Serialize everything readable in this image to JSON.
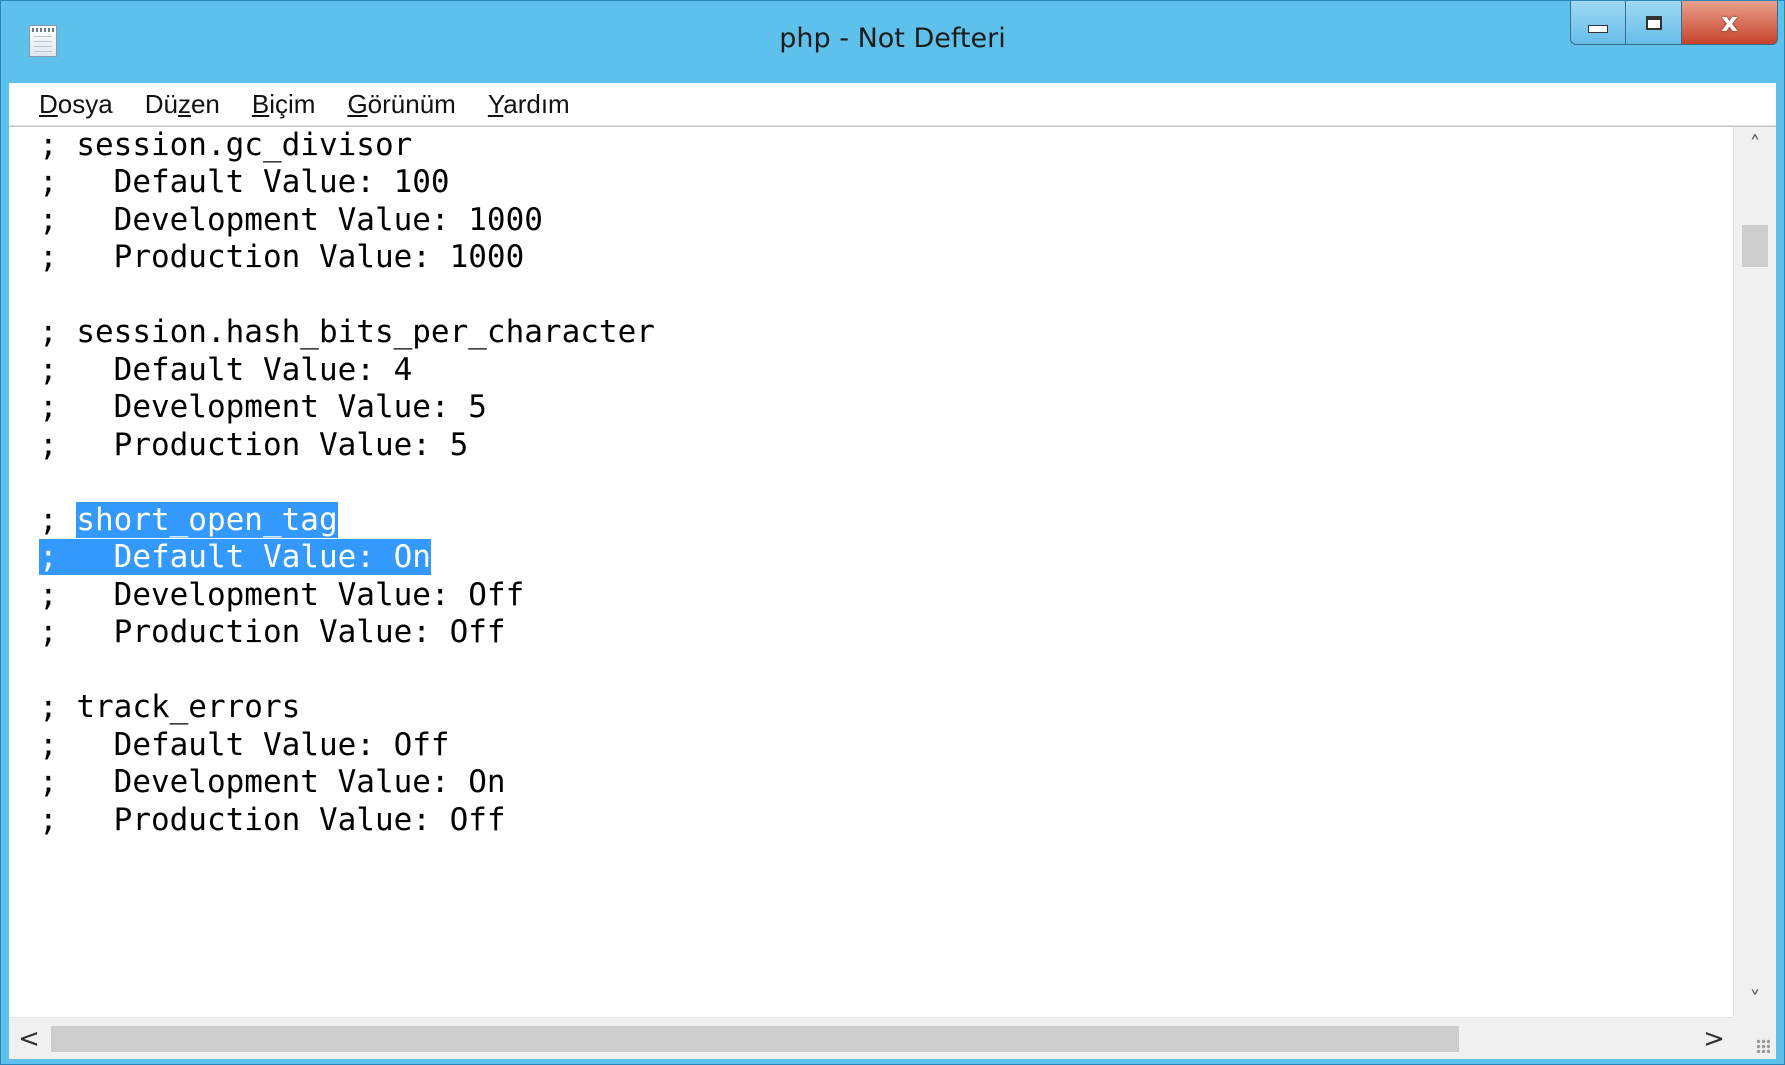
{
  "window": {
    "title": "php - Not Defteri",
    "close_glyph": "x"
  },
  "menu": [
    {
      "accel": "D",
      "rest": "osya"
    },
    {
      "pre": "Dü",
      "accel": "z",
      "rest": "en"
    },
    {
      "accel": "B",
      "rest": "içim"
    },
    {
      "accel": "G",
      "rest": "örünüm"
    },
    {
      "accel": "Y",
      "rest": "ardım"
    }
  ],
  "editor": {
    "lines": [
      {
        "text": "; session.gc_divisor"
      },
      {
        "text": ";   Default Value: 100"
      },
      {
        "text": ";   Development Value: 1000"
      },
      {
        "text": ";   Production Value: 1000"
      },
      {
        "text": ""
      },
      {
        "text": "; session.hash_bits_per_character"
      },
      {
        "text": ";   Default Value: 4"
      },
      {
        "text": ";   Development Value: 5"
      },
      {
        "text": ";   Production Value: 5"
      },
      {
        "text": ""
      },
      {
        "text": "; ",
        "selected": "short_open_tag"
      },
      {
        "text": "",
        "selected": ";   Default Value: On"
      },
      {
        "text": ";   Development Value: Off"
      },
      {
        "text": ";   Production Value: Off"
      },
      {
        "text": ""
      },
      {
        "text": "; track_errors"
      },
      {
        "text": ";   Default Value: Off"
      },
      {
        "text": ";   Development Value: On"
      },
      {
        "text": ";   Production Value: Off"
      }
    ]
  },
  "scrollbars": {
    "up_glyph": "˄",
    "down_glyph": "˅",
    "left_glyph": "<",
    "right_glyph": ">"
  },
  "icons": [
    "notepad-icon",
    "minimize-icon",
    "maximize-icon",
    "close-icon",
    "scroll-up-icon",
    "scroll-down-icon",
    "scroll-left-icon",
    "scroll-right-icon",
    "size-grip-icon"
  ],
  "colors": {
    "titlebar": "#5ec1ec",
    "selection": "#3399ff",
    "close_button": "#c7432b"
  }
}
